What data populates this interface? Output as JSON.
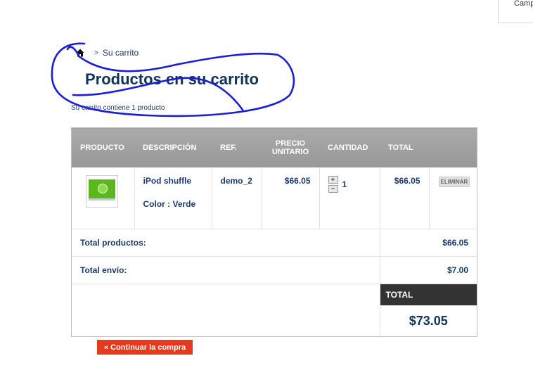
{
  "corner": {
    "text": "Camp"
  },
  "breadcrumb": {
    "separator": ">",
    "current": "Su carrito"
  },
  "page": {
    "title": "Productos en su carrito",
    "cart_count": "Su carrito contiene 1 producto"
  },
  "table": {
    "headers": {
      "product": "PRODUCTO",
      "description": "DESCRIPCIÓN",
      "ref": "REF.",
      "unit_price_line1": "PRECIO",
      "unit_price_line2": "UNITARIO",
      "quantity": "CANTIDAD",
      "total": "TOTAL"
    },
    "item": {
      "name": "iPod shuffle",
      "color": "Color : Verde",
      "ref": "demo_2",
      "unit_price": "$66.05",
      "qty_plus": "+",
      "qty_minus": "−",
      "quantity": "1",
      "total": "$66.05",
      "delete": "ELIMINAR"
    },
    "summary": {
      "products_label": "Total productos:",
      "products_value": "$66.05",
      "shipping_label": "Total envío:",
      "shipping_value": "$7.00",
      "grand_label": "TOTAL",
      "grand_value": "$73.05"
    }
  },
  "actions": {
    "continue": "« Continuar la compra"
  },
  "colors": {
    "accent_button": "#e63a1f",
    "title": "#10335c",
    "scribble": "#1a1fd6"
  },
  "icons": {
    "home": "home-icon"
  }
}
